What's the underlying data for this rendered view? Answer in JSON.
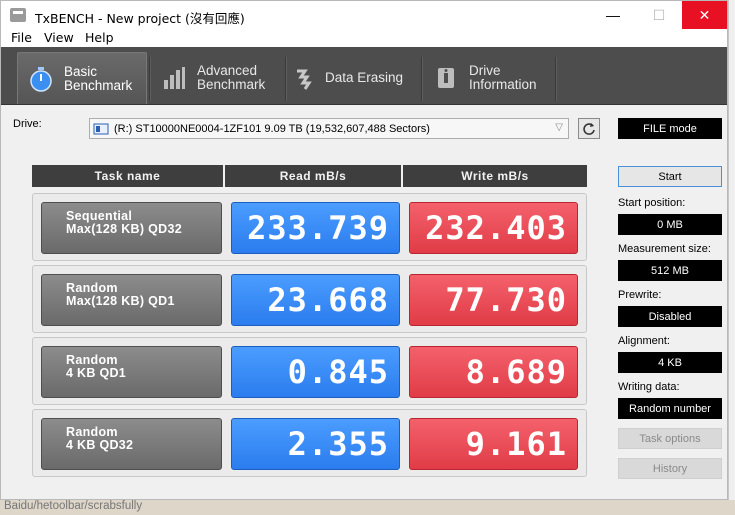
{
  "window": {
    "title": "TxBENCH - New project (沒有回應)",
    "controls": {
      "minimize": "—",
      "maximize": "☐",
      "close": "✕"
    }
  },
  "menu": [
    {
      "label": "File"
    },
    {
      "label": "View"
    },
    {
      "label": "Help"
    }
  ],
  "tabs": [
    {
      "label": "Basic\nBenchmark",
      "icon": "stopwatch-icon",
      "active": true
    },
    {
      "label": "Advanced\nBenchmark",
      "icon": "bar-chart-icon",
      "active": false
    },
    {
      "label": "Data Erasing",
      "icon": "eraser-icon",
      "active": false
    },
    {
      "label": "Drive\nInformation",
      "icon": "drive-info-icon",
      "active": false
    }
  ],
  "drive": {
    "label": "Drive:",
    "selected": "(R:) ST10000NE0004-1ZF101  9.09 TB (19,532,607,488 Sectors)",
    "mode": "FILE mode"
  },
  "table": {
    "headers": [
      "Task name",
      "Read mB/s",
      "Write mB/s"
    ],
    "rows": [
      {
        "name1": "Sequential",
        "name2": "Max(128 KB) QD32",
        "read": "233.739",
        "write": "232.403"
      },
      {
        "name1": "Random",
        "name2": "Max(128 KB) QD1",
        "read": "23.668",
        "write": "77.730"
      },
      {
        "name1": "Random",
        "name2": "4 KB QD1",
        "read": "0.845",
        "write": "8.689"
      },
      {
        "name1": "Random",
        "name2": "4 KB QD32",
        "read": "2.355",
        "write": "9.161"
      }
    ]
  },
  "settings": {
    "start_label": "Start",
    "start_position_label": "Start position:",
    "start_position": "0 MB",
    "measurement_size_label": "Measurement size:",
    "measurement_size": "512 MB",
    "prewrite_label": "Prewrite:",
    "prewrite": "Disabled",
    "alignment_label": "Alignment:",
    "alignment": "4 KB",
    "writing_data_label": "Writing data:",
    "writing_data": "Random number",
    "task_options_label": "Task options",
    "history_label": "History"
  },
  "status": {
    "text": "Baidu/hetoolbar/scrabsfully"
  },
  "colors": {
    "read": "#2b7cee",
    "write": "#e03c47",
    "toolbar": "#4d4d4d",
    "close": "#e81123"
  }
}
